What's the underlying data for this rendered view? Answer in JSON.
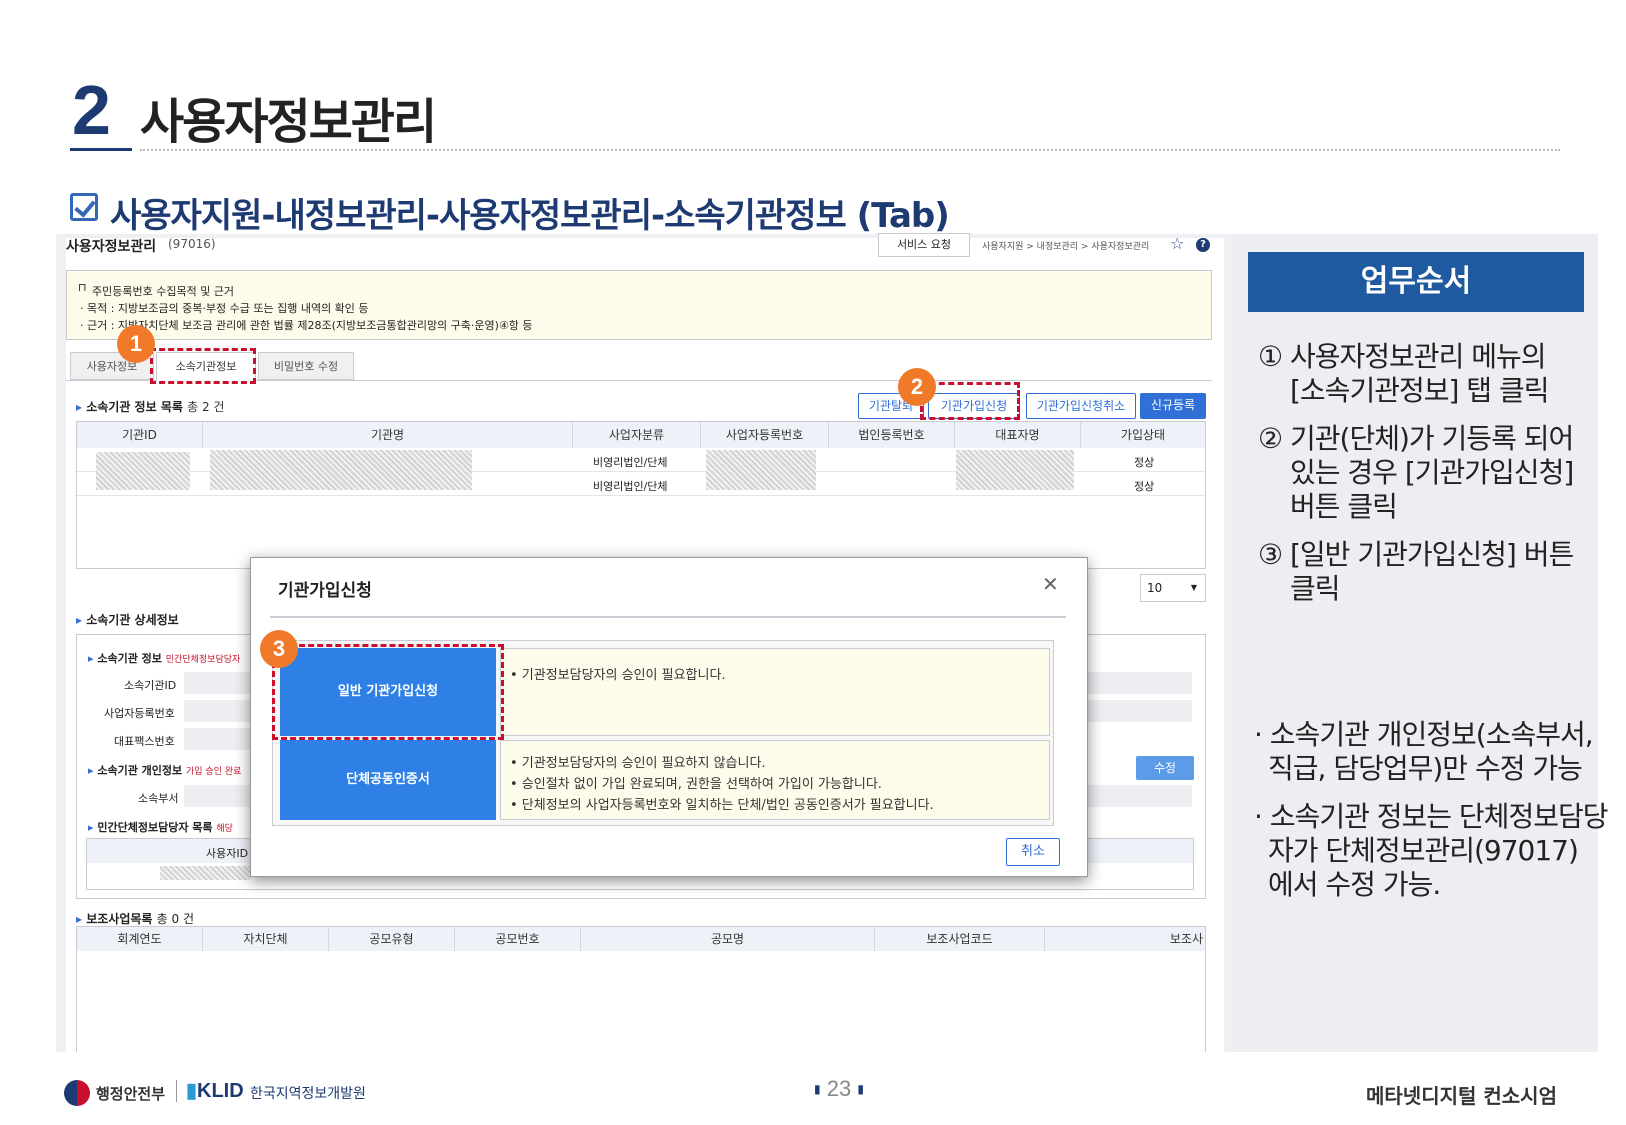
{
  "section": {
    "number": "2",
    "title": "사용자정보관리"
  },
  "subtitle": "사용자지원-내정보관리-사용자정보관리-소속기관정보 (Tab)",
  "screen": {
    "title": "사용자정보관리",
    "code": "(97016)",
    "service_btn": "서비스 요청",
    "breadcrumb": "사용자지원 > 내정보관리 > 사용자정보관리",
    "notice": {
      "title": "주민등록번호 수집목적 및 근거",
      "line1": "· 목적 : 지방보조금의 중복·부정 수급 또는 집행 내역의 확인 등",
      "line2": "· 근거 : 지방자치단체 보조금 관리에 관한 법률 제28조(지방보조금통합관리망의 구축·운영)④항 등"
    },
    "tabs": [
      "사용자정보",
      "소속기관정보",
      "비밀번호 수정"
    ],
    "list": {
      "title": "소속기관 정보 목록",
      "count": "총 2 건",
      "buttons": [
        "기관탈퇴",
        "기관가입신청",
        "기관가입신청취소",
        "신규등록"
      ],
      "columns": [
        "기관ID",
        "기관명",
        "사업자분류",
        "사업자등록번호",
        "법인등록번호",
        "대표자명",
        "가입상태"
      ],
      "rows": [
        {
          "type": "비영리법인/단체",
          "status": "정상"
        },
        {
          "type": "비영리법인/단체",
          "status": "정상"
        }
      ],
      "page_size": "10"
    },
    "detail": {
      "title": "소속기관 상세정보",
      "org_info": "소속기관 정보",
      "org_info_note": "민간단체정보담당자",
      "fields": [
        "소속기관ID",
        "사업자등록번호",
        "대표팩스번호"
      ],
      "personal": "소속기관 개인정보",
      "personal_note": "가입 승인 완료",
      "dept": "소속부서",
      "edit_btn": "수정",
      "manager_list": "민간단체정보담당자 목록",
      "manager_note": "해당",
      "manager_col": "사용자ID"
    },
    "sub_projects": {
      "title": "보조사업목록",
      "count": "총 0 건",
      "columns": [
        "회계연도",
        "자치단체",
        "공모유형",
        "공모번호",
        "공모명",
        "보조사업코드",
        "보조사"
      ]
    }
  },
  "modal": {
    "title": "기관가입신청",
    "option1": {
      "button": "일반 기관가입신청",
      "desc": "• 기관정보담당자의 승인이 필요합니다."
    },
    "option2": {
      "button": "단체공동인증서",
      "desc1": "• 기관정보담당자의 승인이 필요하지 않습니다.",
      "desc2": "• 승인절차 없이 가입 완료되며, 권한을 선택하여 가입이 가능합니다.",
      "desc3": "• 단체정보의 사업자등록번호와 일치하는 단체/법인 공동인증서가 필요합니다."
    },
    "cancel": "취소"
  },
  "markers": [
    "1",
    "2",
    "3"
  ],
  "panel": {
    "title": "업무순서",
    "steps": [
      [
        "① 사용자정보관리 메뉴의",
        "[소속기관정보] 탭 클릭"
      ],
      [
        "② 기관(단체)가 기등록 되어",
        "있는 경우 [기관가입신청]",
        "버튼 클릭"
      ],
      [
        "③ [일반 기관가입신청] 버튼",
        "클릭"
      ]
    ],
    "notes": [
      [
        "· 소속기관 개인정보(소속부서,",
        "직급, 담당업무)만 수정 가능"
      ],
      [
        "· 소속기관 정보는 단체정보담당",
        "자가 단체정보관리(97017)",
        "에서 수정 가능."
      ]
    ]
  },
  "footer": {
    "ministry": "행정안전부",
    "klid": "KLID",
    "klid_name": "한국지역정보개발원",
    "page": "23",
    "company": "메타넷디지털 컨소시엄"
  },
  "colors": {
    "navy": "#1d3a72",
    "blue": "#2f6fd6",
    "orange": "#f07a2a",
    "red": "#c8102e"
  }
}
